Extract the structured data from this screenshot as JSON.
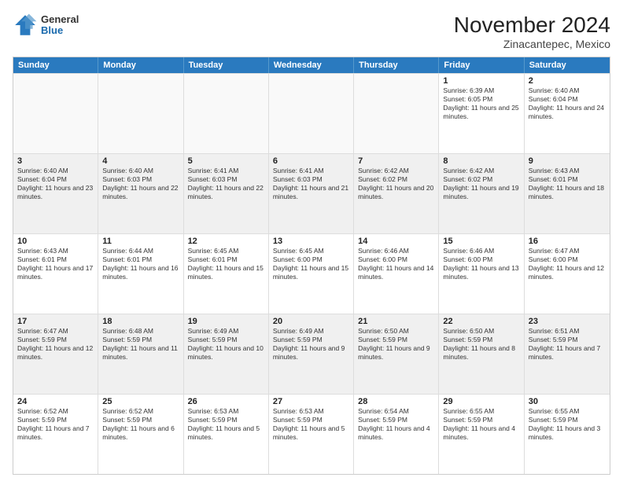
{
  "logo": {
    "general": "General",
    "blue": "Blue"
  },
  "title": "November 2024",
  "subtitle": "Zinacantepec, Mexico",
  "days_of_week": [
    "Sunday",
    "Monday",
    "Tuesday",
    "Wednesday",
    "Thursday",
    "Friday",
    "Saturday"
  ],
  "rows": [
    [
      {
        "day": "",
        "info": "",
        "empty": true
      },
      {
        "day": "",
        "info": "",
        "empty": true
      },
      {
        "day": "",
        "info": "",
        "empty": true
      },
      {
        "day": "",
        "info": "",
        "empty": true
      },
      {
        "day": "",
        "info": "",
        "empty": true
      },
      {
        "day": "1",
        "info": "Sunrise: 6:39 AM\nSunset: 6:05 PM\nDaylight: 11 hours and 25 minutes."
      },
      {
        "day": "2",
        "info": "Sunrise: 6:40 AM\nSunset: 6:04 PM\nDaylight: 11 hours and 24 minutes."
      }
    ],
    [
      {
        "day": "3",
        "info": "Sunrise: 6:40 AM\nSunset: 6:04 PM\nDaylight: 11 hours and 23 minutes."
      },
      {
        "day": "4",
        "info": "Sunrise: 6:40 AM\nSunset: 6:03 PM\nDaylight: 11 hours and 22 minutes."
      },
      {
        "day": "5",
        "info": "Sunrise: 6:41 AM\nSunset: 6:03 PM\nDaylight: 11 hours and 22 minutes."
      },
      {
        "day": "6",
        "info": "Sunrise: 6:41 AM\nSunset: 6:03 PM\nDaylight: 11 hours and 21 minutes."
      },
      {
        "day": "7",
        "info": "Sunrise: 6:42 AM\nSunset: 6:02 PM\nDaylight: 11 hours and 20 minutes."
      },
      {
        "day": "8",
        "info": "Sunrise: 6:42 AM\nSunset: 6:02 PM\nDaylight: 11 hours and 19 minutes."
      },
      {
        "day": "9",
        "info": "Sunrise: 6:43 AM\nSunset: 6:01 PM\nDaylight: 11 hours and 18 minutes."
      }
    ],
    [
      {
        "day": "10",
        "info": "Sunrise: 6:43 AM\nSunset: 6:01 PM\nDaylight: 11 hours and 17 minutes."
      },
      {
        "day": "11",
        "info": "Sunrise: 6:44 AM\nSunset: 6:01 PM\nDaylight: 11 hours and 16 minutes."
      },
      {
        "day": "12",
        "info": "Sunrise: 6:45 AM\nSunset: 6:01 PM\nDaylight: 11 hours and 15 minutes."
      },
      {
        "day": "13",
        "info": "Sunrise: 6:45 AM\nSunset: 6:00 PM\nDaylight: 11 hours and 15 minutes."
      },
      {
        "day": "14",
        "info": "Sunrise: 6:46 AM\nSunset: 6:00 PM\nDaylight: 11 hours and 14 minutes."
      },
      {
        "day": "15",
        "info": "Sunrise: 6:46 AM\nSunset: 6:00 PM\nDaylight: 11 hours and 13 minutes."
      },
      {
        "day": "16",
        "info": "Sunrise: 6:47 AM\nSunset: 6:00 PM\nDaylight: 11 hours and 12 minutes."
      }
    ],
    [
      {
        "day": "17",
        "info": "Sunrise: 6:47 AM\nSunset: 5:59 PM\nDaylight: 11 hours and 12 minutes."
      },
      {
        "day": "18",
        "info": "Sunrise: 6:48 AM\nSunset: 5:59 PM\nDaylight: 11 hours and 11 minutes."
      },
      {
        "day": "19",
        "info": "Sunrise: 6:49 AM\nSunset: 5:59 PM\nDaylight: 11 hours and 10 minutes."
      },
      {
        "day": "20",
        "info": "Sunrise: 6:49 AM\nSunset: 5:59 PM\nDaylight: 11 hours and 9 minutes."
      },
      {
        "day": "21",
        "info": "Sunrise: 6:50 AM\nSunset: 5:59 PM\nDaylight: 11 hours and 9 minutes."
      },
      {
        "day": "22",
        "info": "Sunrise: 6:50 AM\nSunset: 5:59 PM\nDaylight: 11 hours and 8 minutes."
      },
      {
        "day": "23",
        "info": "Sunrise: 6:51 AM\nSunset: 5:59 PM\nDaylight: 11 hours and 7 minutes."
      }
    ],
    [
      {
        "day": "24",
        "info": "Sunrise: 6:52 AM\nSunset: 5:59 PM\nDaylight: 11 hours and 7 minutes."
      },
      {
        "day": "25",
        "info": "Sunrise: 6:52 AM\nSunset: 5:59 PM\nDaylight: 11 hours and 6 minutes."
      },
      {
        "day": "26",
        "info": "Sunrise: 6:53 AM\nSunset: 5:59 PM\nDaylight: 11 hours and 5 minutes."
      },
      {
        "day": "27",
        "info": "Sunrise: 6:53 AM\nSunset: 5:59 PM\nDaylight: 11 hours and 5 minutes."
      },
      {
        "day": "28",
        "info": "Sunrise: 6:54 AM\nSunset: 5:59 PM\nDaylight: 11 hours and 4 minutes."
      },
      {
        "day": "29",
        "info": "Sunrise: 6:55 AM\nSunset: 5:59 PM\nDaylight: 11 hours and 4 minutes."
      },
      {
        "day": "30",
        "info": "Sunrise: 6:55 AM\nSunset: 5:59 PM\nDaylight: 11 hours and 3 minutes."
      }
    ]
  ]
}
